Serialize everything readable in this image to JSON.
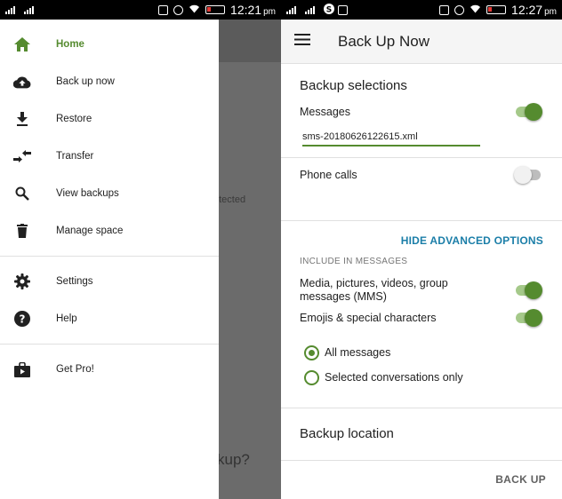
{
  "left_status": {
    "time": "12:21",
    "ampm": "pm"
  },
  "right_status": {
    "time": "12:27",
    "ampm": "pm"
  },
  "behind": {
    "ghost_text_1": "otected",
    "ghost_text_2": "kup?"
  },
  "drawer": {
    "items": [
      {
        "label": "Home",
        "icon": "home-icon",
        "active": true
      },
      {
        "label": "Back up now",
        "icon": "cloud-upload-icon"
      },
      {
        "label": "Restore",
        "icon": "download-icon"
      },
      {
        "label": "Transfer",
        "icon": "transfer-arrows-icon"
      },
      {
        "label": "View backups",
        "icon": "search-icon"
      },
      {
        "label": "Manage space",
        "icon": "trash-icon"
      },
      {
        "label": "Settings",
        "icon": "gear-icon"
      },
      {
        "label": "Help",
        "icon": "help-icon"
      },
      {
        "label": "Get Pro!",
        "icon": "store-bag-icon"
      }
    ]
  },
  "backup_screen": {
    "title": "Back Up Now",
    "selections_title": "Backup selections",
    "messages_label": "Messages",
    "messages_on": true,
    "filename": "sms-20180626122615.xml",
    "calls_label": "Phone calls",
    "calls_on": false,
    "advanced_link": "HIDE ADVANCED OPTIONS",
    "include_label": "INCLUDE IN MESSAGES",
    "mms_label": "Media, pictures, videos, group messages (MMS)",
    "mms_on": true,
    "emoji_label": "Emojis & special characters",
    "emoji_on": true,
    "radio_all": "All messages",
    "radio_selected": "Selected conversations only",
    "selected_radio": "all",
    "location_title": "Backup location",
    "backup_button": "BACK UP"
  },
  "colors": {
    "accent_green": "#558b2f",
    "link_blue": "#1b7ea8"
  }
}
